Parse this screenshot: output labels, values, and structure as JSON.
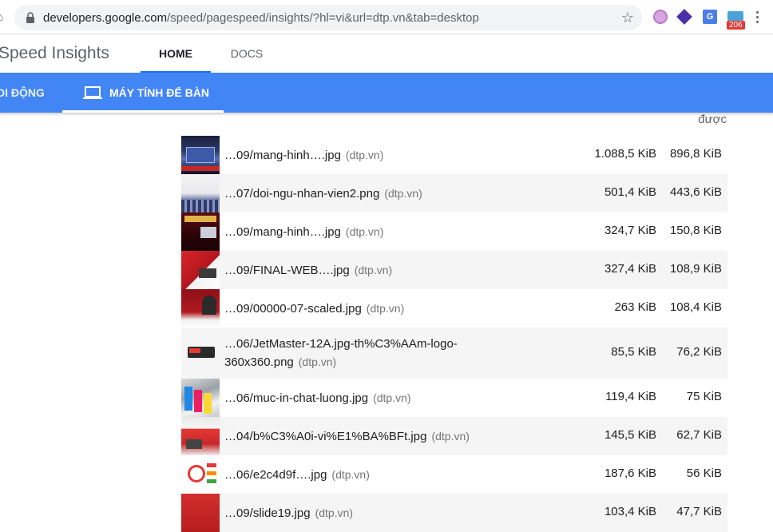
{
  "browser": {
    "url_host": "developers.google.com",
    "url_path": "/speed/pagespeed/insights/?hl=vi&url=dtp.vn&tab=desktop",
    "ext_badge": "206"
  },
  "header": {
    "title": "Speed Insights",
    "nav_home": "HOME",
    "nav_docs": "DOCS"
  },
  "tabs": {
    "mobile": "DI ĐỘNG",
    "desktop": "MÁY TÍNH ĐỂ BÀN"
  },
  "table": {
    "savings_header": "được",
    "rows": [
      {
        "url": "…09/mang-hinh….jpg",
        "host": "(dtp.vn)",
        "size": "1.088,5 KiB",
        "savings": "896,8 KiB"
      },
      {
        "url": "…07/doi-ngu-nhan-vien2.png",
        "host": "(dtp.vn)",
        "size": "501,4 KiB",
        "savings": "443,6 KiB"
      },
      {
        "url": "…09/mang-hinh….jpg",
        "host": "(dtp.vn)",
        "size": "324,7 KiB",
        "savings": "150,8 KiB"
      },
      {
        "url": "…09/FINAL-WEB….jpg",
        "host": "(dtp.vn)",
        "size": "327,4 KiB",
        "savings": "108,9 KiB"
      },
      {
        "url": "…09/00000-07-scaled.jpg",
        "host": "(dtp.vn)",
        "size": "263 KiB",
        "savings": "108,4 KiB"
      },
      {
        "url": "…06/JetMaster-12A.jpg-th%C3%AAm-logo-",
        "url2": "360x360.png",
        "host": "(dtp.vn)",
        "size": "85,5 KiB",
        "savings": "76,2 KiB"
      },
      {
        "url": "…06/muc-in-chat-luong.jpg",
        "host": "(dtp.vn)",
        "size": "119,4 KiB",
        "savings": "75 KiB"
      },
      {
        "url": "…04/b%C3%A0i-vi%E1%BA%BFt.jpg",
        "host": "(dtp.vn)",
        "size": "145,5 KiB",
        "savings": "62,7 KiB"
      },
      {
        "url": "…06/e2c4d9f….jpg",
        "host": "(dtp.vn)",
        "size": "187,6 KiB",
        "savings": "56 KiB"
      },
      {
        "url": "…09/slide19.jpg",
        "host": "(dtp.vn)",
        "size": "103,4 KiB",
        "savings": "47,7 KiB"
      }
    ]
  }
}
